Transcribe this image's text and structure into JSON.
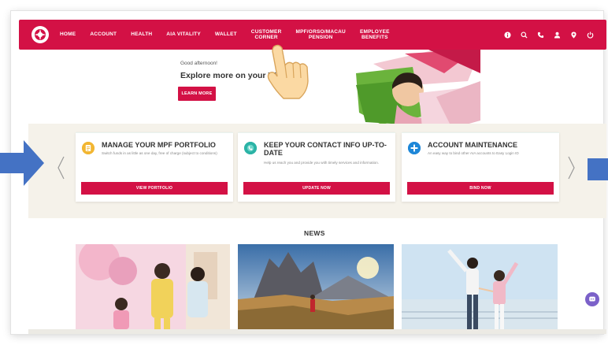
{
  "nav": {
    "items": [
      {
        "label": "HOME"
      },
      {
        "label": "ACCOUNT"
      },
      {
        "label": "HEALTH"
      },
      {
        "label": "AIA VITALITY"
      },
      {
        "label": "WALLET"
      },
      {
        "label": "CUSTOMER\nCORNER"
      },
      {
        "label": "MPF/ORSO/MACAU\nPENSION"
      },
      {
        "label": "EMPLOYEE\nBENEFITS"
      }
    ],
    "icons": [
      "info-icon",
      "search-icon",
      "phone-icon",
      "user-icon",
      "location-icon",
      "power-icon"
    ]
  },
  "hero": {
    "greeting": "Good afternoon!",
    "title": "Explore more on your Wellne",
    "button": "LEARN MORE"
  },
  "cards": [
    {
      "title": "MANAGE YOUR MPF PORTFOLIO",
      "desc": "Switch funds in as little as one day, free of charge (subject to conditions)",
      "button": "VIEW PORTFOLIO",
      "icon": "portfolio-icon",
      "icon_color": "#f2b632"
    },
    {
      "title": "KEEP YOUR CONTACT INFO UP-TO-DATE",
      "desc": "Help us reach you and provide you with timely services and information.",
      "button": "UPDATE NOW",
      "icon": "contact-icon",
      "icon_color": "#2bb3a6"
    },
    {
      "title": "ACCOUNT MAINTENANCE",
      "desc": "An easy way to bind other AIA accounts to Easy Login ID",
      "button": "BIND NOW",
      "icon": "plus-icon",
      "icon_color": "#1e87d8"
    }
  ],
  "news": {
    "title": "NEWS"
  },
  "colors": {
    "brand_red": "#d31145",
    "band_bg": "#f5f2ea",
    "annotation_blue": "#4472c4"
  }
}
